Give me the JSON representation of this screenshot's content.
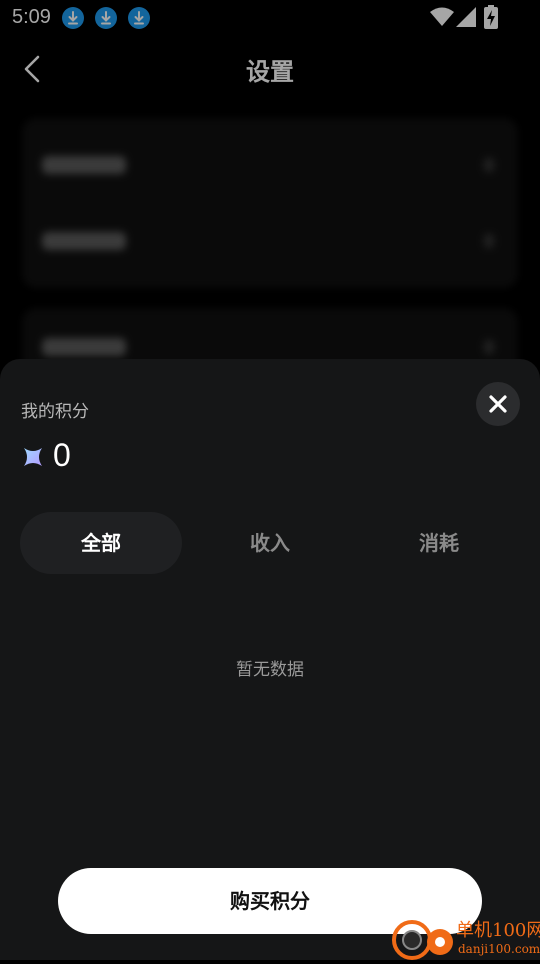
{
  "status_bar": {
    "time": "5:09",
    "icons": [
      "download-icon",
      "download-icon",
      "download-icon",
      "wifi-icon",
      "signal-icon",
      "battery-charging-icon"
    ],
    "accent": "#1e9bf0"
  },
  "header": {
    "title": "设置",
    "back_icon": "chevron-left-icon"
  },
  "sheet": {
    "label": "我的积分",
    "points": "0",
    "close_icon": "close-icon",
    "tabs": [
      {
        "label": "全部",
        "active": true
      },
      {
        "label": "收入",
        "active": false
      },
      {
        "label": "消耗",
        "active": false
      }
    ],
    "empty_text": "暂无数据",
    "buy_label": "购买积分"
  },
  "watermark": {
    "text": "单机100网",
    "url": "danji100.com",
    "color": "#f06b17"
  }
}
